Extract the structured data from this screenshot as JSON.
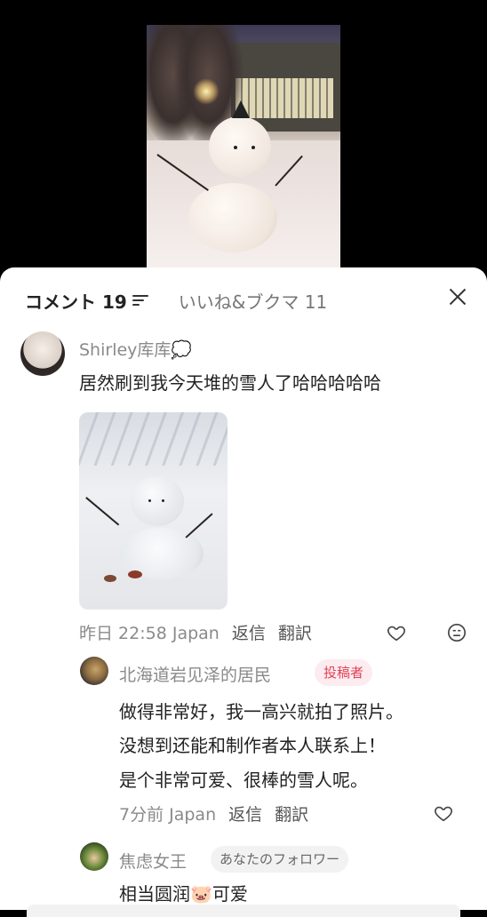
{
  "header": {
    "comments_label": "コメント 19",
    "likes_label": "いいね&ブクマ 11"
  },
  "comments": [
    {
      "username": "Shirley库库💭",
      "text": "居然刷到我今天堆的雪人了哈哈哈哈哈",
      "time": "昨日 22:58 Japan",
      "reply_label": "返信",
      "translate_label": "翻訳"
    },
    {
      "username": "北海道岩见泽的居民",
      "badge": "投稿者",
      "lines": [
        "做得非常好，我一高兴就拍了照片。",
        "没想到还能和制作者本人联系上！",
        "是个非常可爱、很棒的雪人呢。"
      ],
      "time": "7分前 Japan",
      "reply_label": "返信",
      "translate_label": "翻訳"
    },
    {
      "username": "焦虑女王",
      "badge": "あなたのフォロワー",
      "text": "相当圆润🐷可爱"
    }
  ],
  "colors": {
    "author_badge_bg": "#fdecef",
    "author_badge_text": "#e0435a",
    "follower_badge_bg": "#f2f2f2",
    "follower_badge_text": "#666666"
  }
}
